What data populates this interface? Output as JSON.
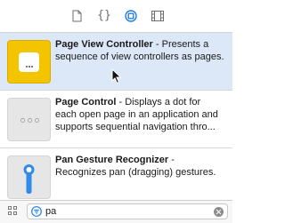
{
  "toolbar": {
    "tabs": [
      {
        "icon": "file-icon",
        "selected": false
      },
      {
        "icon": "braces-icon",
        "label": "{}",
        "selected": false
      },
      {
        "icon": "object-library-icon",
        "selected": true
      },
      {
        "icon": "media-library-icon",
        "selected": false
      }
    ],
    "accent": "#1f7ee6"
  },
  "library": {
    "items": [
      {
        "title": "Page View Controller",
        "sep": " - ",
        "description": "Presents a sequence of view controllers as pages.",
        "icon": "page-view-controller-icon",
        "selected": true
      },
      {
        "title": "Page Control",
        "sep": " - ",
        "description": "Displays a dot for each open page in an application and supports sequential navigation thro...",
        "icon": "page-control-icon",
        "selected": false
      },
      {
        "title": "Pan Gesture Recognizer",
        "sep": " - ",
        "description": "Recognizes pan (dragging) gestures.",
        "icon": "pan-gesture-icon",
        "selected": false
      }
    ],
    "selected_bg": "#dce8f7"
  },
  "filter": {
    "value": "pa"
  }
}
